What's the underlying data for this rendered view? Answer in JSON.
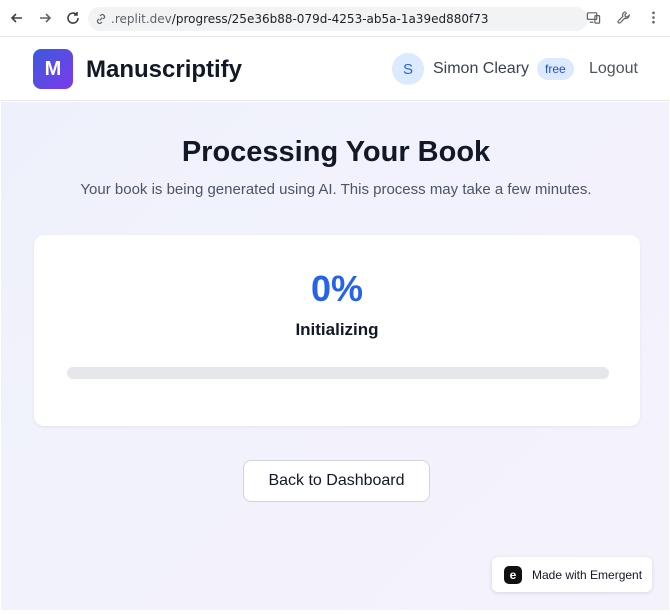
{
  "browser": {
    "url_host": ".replit.dev",
    "url_path": "/progress/25e36b88-079d-4253-ab5a-1a39ed880f73"
  },
  "header": {
    "logo_letter": "M",
    "brand": "Manuscriptify",
    "user_initial": "S",
    "user_name": "Simon Cleary",
    "plan": "free",
    "logout_label": "Logout"
  },
  "main": {
    "title": "Processing Your Book",
    "subtitle": "Your book is being generated using AI. This process may take a few minutes.",
    "progress_percent": 0,
    "progress_text": "0%",
    "stage": "Initializing",
    "back_label": "Back to Dashboard"
  },
  "badge": {
    "label": "Made with Emergent"
  },
  "colors": {
    "accent": "#2563eb",
    "logo_gradient_start": "#3b5bdb",
    "logo_gradient_end": "#7c3aed"
  }
}
